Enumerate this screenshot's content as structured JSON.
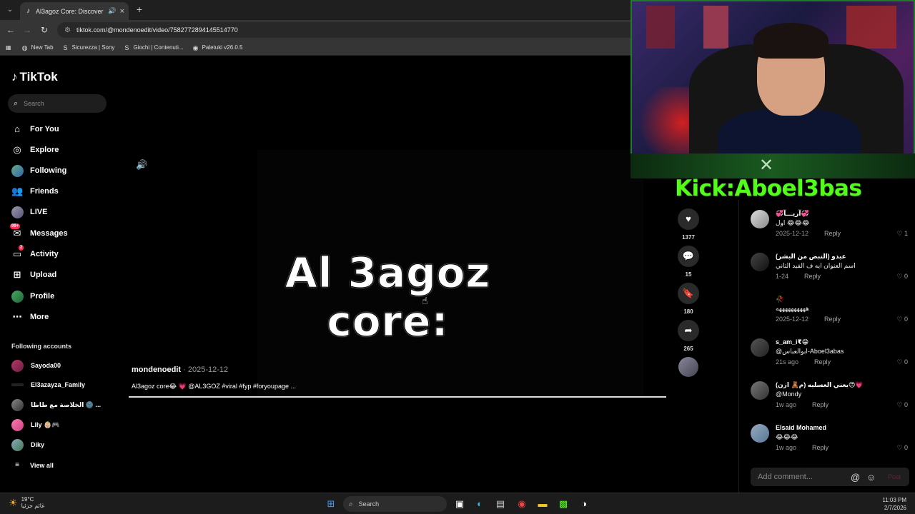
{
  "browser": {
    "tab_title": "Al3agoz Core: Discover the",
    "url": "tiktok.com/@mondenoedit/video/7582772894145514770",
    "bookmarks": [
      "New Tab",
      "Sicurezza | Sony",
      "Giochi | Contenuti...",
      "Paletuki v26.0.5"
    ]
  },
  "sidebar": {
    "logo": "TikTok",
    "search_placeholder": "Search",
    "nav": [
      {
        "label": "For You"
      },
      {
        "label": "Explore"
      },
      {
        "label": "Following"
      },
      {
        "label": "Friends"
      },
      {
        "label": "LIVE"
      },
      {
        "label": "Messages",
        "badge": "99+"
      },
      {
        "label": "Activity",
        "badge": "2"
      },
      {
        "label": "Upload"
      },
      {
        "label": "Profile"
      },
      {
        "label": "More"
      }
    ],
    "following_title": "Following accounts",
    "following": [
      "Sayoda00",
      "El3azayza_Family",
      "الخلاصة مع طاظا 🌚 ...",
      "Lily 👶🏼🎮",
      "Diky"
    ],
    "view_all": "View all"
  },
  "video": {
    "overlay_text": "Al 3agoz core:",
    "author": "mondenoedit",
    "date": "· 2025-12-12",
    "caption": "Al3agoz core😂 💗 @AL3GOZ #viral #fyp #foryoupage ...",
    "progress": 1.0
  },
  "actions": {
    "likes": "1377",
    "comments": "15",
    "saves": "180",
    "shares": "265"
  },
  "overlay": {
    "kick": "Kick:Aboel3bas"
  },
  "comments": [
    {
      "name": "💞آريـــآ💞",
      "text": "اول 😂😂😂",
      "time": "2025-12-12",
      "reply": "Reply",
      "likes": "1"
    },
    {
      "name": "عبدو (النبض من البشر)",
      "text": "اسم العنوان ايه ف الفيد التاني",
      "time": "1-24",
      "reply": "Reply",
      "likes": "0"
    },
    {
      "name": "🥀",
      "text": "ههههههههههه",
      "time": "2025-12-12",
      "reply": "Reply",
      "likes": "0"
    },
    {
      "name": "s_am_i₹😁",
      "text": "@ابوالعباس-Aboel3abas",
      "time": "21s ago",
      "reply": "Reply",
      "likes": "0"
    },
    {
      "name": "يعني العسليه (م🧸 ازن)😍💗",
      "text": "@Mondy",
      "time": "1w ago",
      "reply": "Reply",
      "likes": "0"
    },
    {
      "name": "Elsaid Mohamed",
      "text": "😂😂😂",
      "time": "1w ago",
      "reply": "Reply",
      "likes": "0"
    }
  ],
  "add_comment": {
    "placeholder": "Add comment...",
    "post": "Post"
  },
  "taskbar": {
    "temp": "19°C",
    "weather_desc": "غائم جزئيا",
    "search": "Search",
    "time": "11:03 PM",
    "date": "2/7/2026"
  }
}
